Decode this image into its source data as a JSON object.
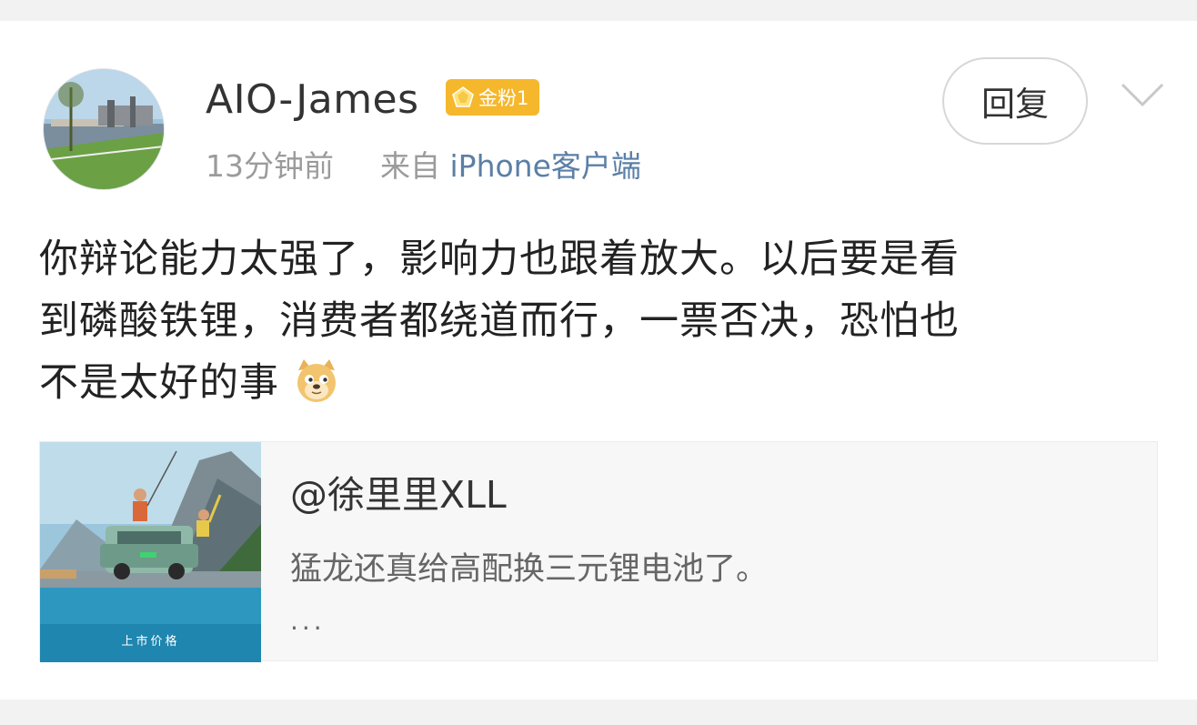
{
  "post": {
    "author": {
      "name": "AIO-James",
      "badge": "金粉1"
    },
    "meta": {
      "time": "13分钟前",
      "from_prefix": "来自",
      "source": "iPhone客户端"
    },
    "reply_label": "回复",
    "text_lines": [
      "你辩论能力太强了，影响力也跟着放大。以后要是看",
      "到磷酸铁锂，消费者都绕道而行，一票否决，恐怕也",
      "不是太好的事"
    ],
    "quote": {
      "author": "@徐里里XLL",
      "text": "猛龙还真给高配换三元锂电池了。",
      "more": "...",
      "thumb_caption": "上市价格"
    }
  },
  "icons": {
    "menu": "chevron-down-icon",
    "emoji": "doge-emoji-icon",
    "badge": "gold-fan-gem-icon"
  },
  "colors": {
    "badge": "#f5b72c",
    "link": "#5b7fa6",
    "meta": "#9b9b9b"
  }
}
